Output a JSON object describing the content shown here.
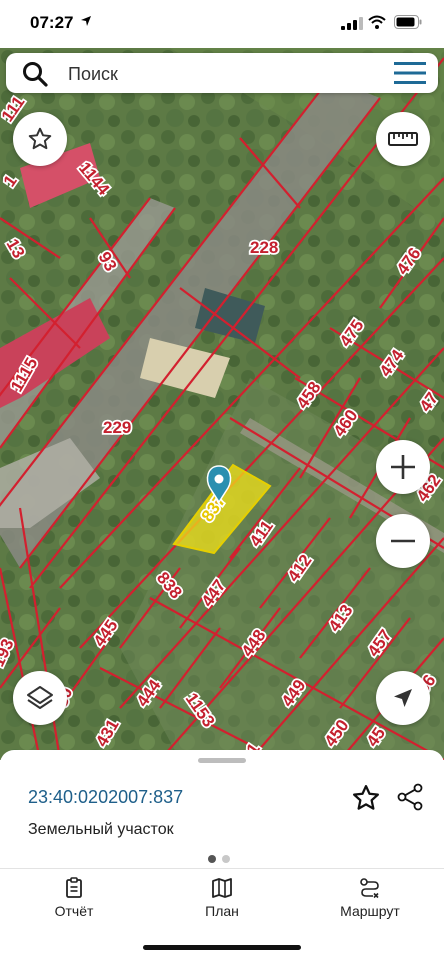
{
  "status_bar": {
    "time": "07:27"
  },
  "search": {
    "placeholder": "Поиск"
  },
  "map": {
    "parcel_labels": [
      "111",
      "1144",
      "1",
      "13",
      "93",
      "228",
      "476",
      "475",
      "474",
      "47",
      "1115",
      "458",
      "460",
      "229",
      "837",
      "411",
      "462",
      "838",
      "412",
      "447",
      "413",
      "457",
      "445",
      "448",
      "444",
      "449",
      "450",
      "456",
      "30",
      "1153",
      "431",
      "45",
      "193",
      "1"
    ],
    "selected_parcel": "837"
  },
  "parcel_card": {
    "cadastral_number": "23:40:0202007:837",
    "type": "Земельный участок",
    "page_count": 2,
    "active_page": 1
  },
  "tabs": [
    {
      "label": "Отчёт",
      "icon": "report-icon"
    },
    {
      "label": "План",
      "icon": "map-plan-icon"
    },
    {
      "label": "Маршрут",
      "icon": "route-icon"
    }
  ],
  "colors": {
    "accent": "#1e6a96",
    "parcel_border": "#d3202f",
    "selected_parcel_fill": "#f2e21a",
    "marker": "#2a8fb0"
  }
}
